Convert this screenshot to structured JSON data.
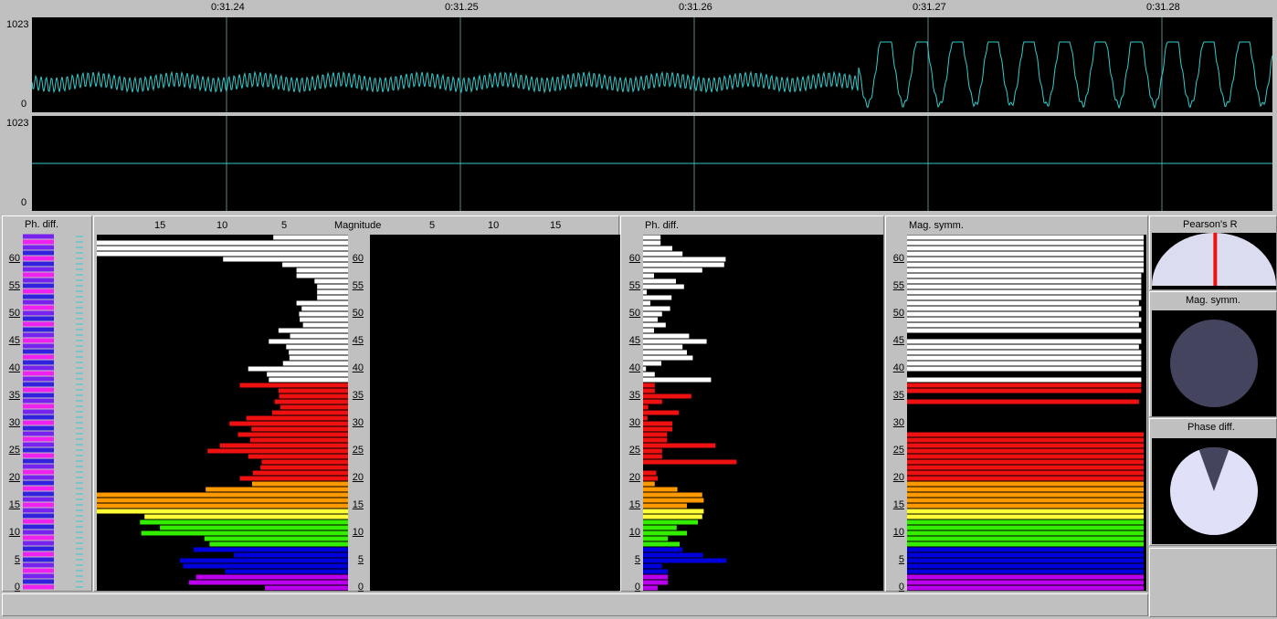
{
  "timeline": {
    "time_labels": [
      "0:31.24",
      "0:31.25",
      "0:31.26",
      "0:31.27",
      "0:31.28"
    ]
  },
  "waveform_top": {
    "ymax": "1023",
    "ymin": "0"
  },
  "waveform_bottom": {
    "ymax": "1023",
    "ymin": "0"
  },
  "panels": {
    "phase_left_title": "Ph. diff.",
    "magnitude_title": "Magnitude",
    "magnitude_ticks_left": [
      "15",
      "10",
      "5"
    ],
    "magnitude_ticks_right": [
      "5",
      "10",
      "15"
    ],
    "phase_mid_title": "Ph. diff.",
    "mag_symm_title": "Mag. symm.",
    "pearson_title": "Pearson's R",
    "mag_symm_dial_title": "Mag. symm.",
    "phase_dial_title": "Phase diff."
  },
  "row_ticks": [
    "60",
    "55",
    "50",
    "45",
    "40",
    "35",
    "30",
    "25",
    "20",
    "15",
    "10",
    "5",
    "0"
  ],
  "colors": {
    "white": "#ffffff",
    "red": "#ee1111",
    "orange": "#ff9900",
    "yellow": "#ffff33",
    "green": "#33ee00",
    "blue": "#0000dd",
    "purple": "#bb00ee",
    "wave": "#33cccc"
  },
  "bands": [
    {
      "from": 38,
      "to": 64,
      "color": "white"
    },
    {
      "from": 20,
      "to": 37,
      "color": "red"
    },
    {
      "from": 15,
      "to": 19,
      "color": "orange"
    },
    {
      "from": 13,
      "to": 14,
      "color": "yellow"
    },
    {
      "from": 8,
      "to": 12,
      "color": "green"
    },
    {
      "from": 3,
      "to": 7,
      "color": "blue"
    },
    {
      "from": 0,
      "to": 2,
      "color": "purple"
    }
  ],
  "magnitude": [
    12.9,
    24.7,
    23.6,
    19.1,
    25.6,
    26.1,
    17.7,
    24.0,
    21.5,
    22.3,
    32.1,
    29.2,
    32.3,
    31.6,
    39.0,
    39.0,
    39.0,
    39.0,
    22.1,
    14.9,
    16.8,
    14.8,
    13.6,
    13.4,
    15.5,
    21.8,
    19.9,
    15.2,
    17.1,
    15.0,
    18.4,
    15.8,
    11.8,
    10.5,
    11.4,
    10.7,
    10.8,
    16.8,
    12.3,
    12.6,
    15.5,
    10.1,
    9.1,
    9.2,
    9.6,
    12.3,
    9.0,
    10.8,
    7.0,
    7.5,
    7.6,
    7.2,
    8.0,
    4.8,
    4.8,
    4.8,
    5.2,
    8.0,
    8.0,
    10.2,
    19.4,
    39.0,
    39.0,
    39.0,
    11.6
  ],
  "phase_bars": [
    2.0,
    3.4,
    3.4,
    3.4,
    2.6,
    11.4,
    8.2,
    5.4,
    5.0,
    3.4,
    6.0,
    4.6,
    7.5,
    8.1,
    8.3,
    6.0,
    8.3,
    8.1,
    4.7,
    1.6,
    2.0,
    1.8,
    0,
    12.8,
    2.6,
    2.6,
    9.9,
    3.3,
    3.3,
    4.0,
    4.0,
    0.6,
    4.9,
    0.7,
    2.6,
    6.6,
    1.6,
    1.6,
    9.3,
    1.6,
    0.4,
    2.5,
    6.8,
    6.0,
    5.4,
    8.7,
    6.3,
    1.5,
    3.1,
    2.0,
    2.6,
    3.7,
    1.0,
    3.9,
    0.5,
    5.6,
    4.5,
    1.5,
    8.1,
    11.1,
    11.3,
    5.4,
    4.0,
    2.4,
    2.4
  ],
  "mag_symm_bars": [
    1,
    1,
    1,
    1,
    1,
    1,
    1,
    1,
    1,
    1,
    1,
    1,
    1,
    1,
    1,
    1,
    1,
    1,
    1,
    1,
    1,
    1,
    1,
    1,
    1,
    1,
    1,
    1,
    1,
    0,
    0,
    0,
    0,
    0,
    0.98,
    0,
    0.99,
    0.99,
    0.99,
    0,
    0.99,
    0.99,
    0.99,
    0.99,
    0.98,
    0.99,
    0,
    0.99,
    0.98,
    0.99,
    0.98,
    0.99,
    0.98,
    0.99,
    0.99,
    0.99,
    0.99,
    0.99,
    1,
    1,
    1,
    1,
    1,
    1,
    1
  ],
  "pearson": {
    "r": 0.02
  },
  "mag_symm_dial": {
    "fraction": 1.0
  },
  "phase_dial": {
    "missing_fraction": 0.11
  }
}
